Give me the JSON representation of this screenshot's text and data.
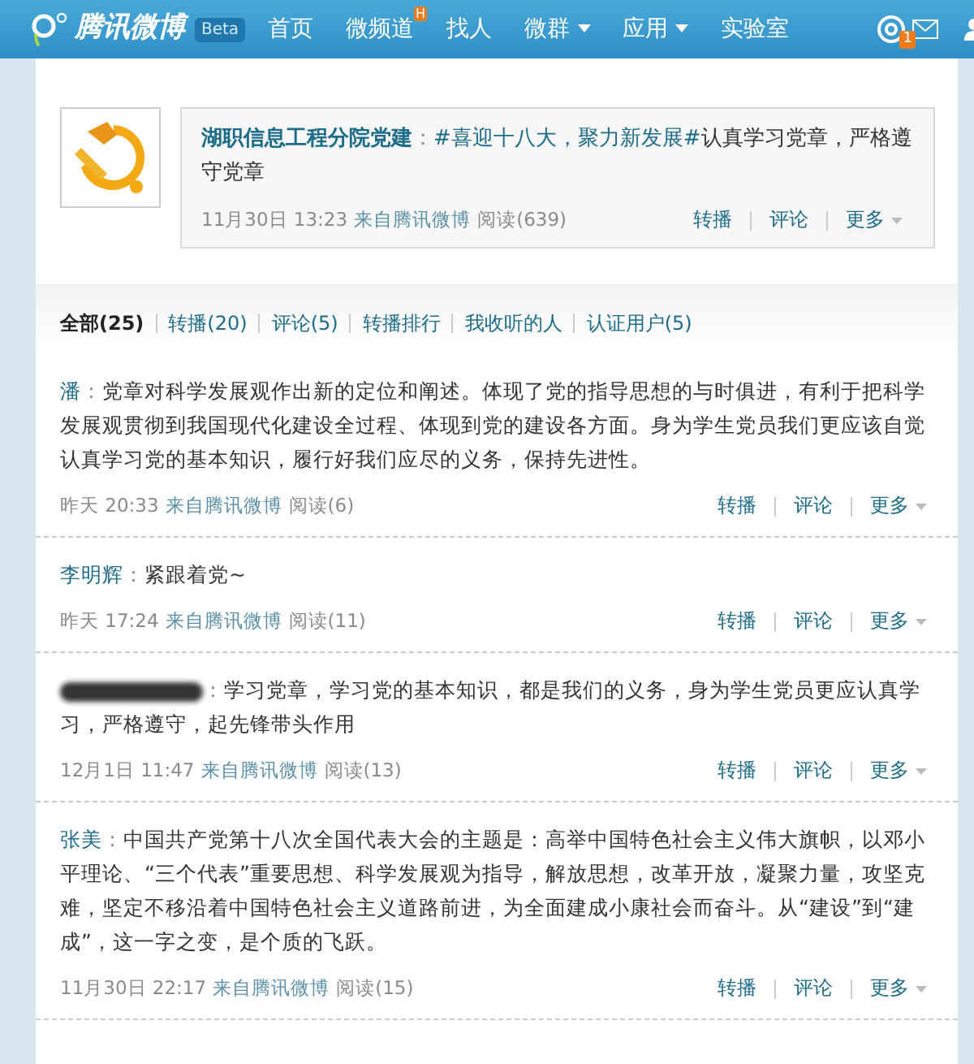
{
  "navbar": {
    "logo": "腾讯微博",
    "beta": "Beta",
    "items": [
      {
        "label": "首页",
        "hot": false,
        "dropdown": false
      },
      {
        "label": "微频道",
        "hot": true,
        "dropdown": false
      },
      {
        "label": "找人",
        "hot": false,
        "dropdown": false
      },
      {
        "label": "微群",
        "hot": false,
        "dropdown": true
      },
      {
        "label": "应用",
        "hot": false,
        "dropdown": true
      },
      {
        "label": "实验室",
        "hot": false,
        "dropdown": false
      }
    ],
    "hot_badge": "H",
    "mention_count": "1"
  },
  "original_post": {
    "author": "湖职信息工程分院党建",
    "colon": "：",
    "topic": "#喜迎十八大，聚力新发展#",
    "text": "认真学习党章，严格遵守党章",
    "time": "11月30日 13:23",
    "source": "来自腾讯微博",
    "reads": "阅读(639)",
    "actions": [
      "转播",
      "评论",
      "更多"
    ]
  },
  "filter_tabs": [
    {
      "label": "全部(25)",
      "selected": true
    },
    {
      "label": "转播(20)",
      "selected": false
    },
    {
      "label": "评论(5)",
      "selected": false
    },
    {
      "label": "转播排行",
      "selected": false
    },
    {
      "label": "我收听的人",
      "selected": false
    },
    {
      "label": "认证用户(5)",
      "selected": false
    }
  ],
  "comments": [
    {
      "author": "潘",
      "colon": "：",
      "redacted": false,
      "text": "党章对科学发展观作出新的定位和阐述。体现了党的指导思想的与时俱进，有利于把科学发展观贯彻到我国现代化建设全过程、体现到党的建设各方面。身为学生党员我们更应该自觉认真学习党的基本知识，履行好我们应尽的义务，保持先进性。",
      "time": "昨天 20:33",
      "source": "来自腾讯微博",
      "reads": "阅读(6)",
      "actions": [
        "转播",
        "评论",
        "更多"
      ]
    },
    {
      "author": "李明辉",
      "colon": "：",
      "redacted": false,
      "text": "紧跟着党~",
      "time": "昨天 17:24",
      "source": "来自腾讯微博",
      "reads": "阅读(11)",
      "actions": [
        "转播",
        "评论",
        "更多"
      ]
    },
    {
      "redacted": true,
      "colon": "：",
      "text": "学习党章，学习党的基本知识，都是我们的义务，身为学生党员更应认真学习，严格遵守，起先锋带头作用",
      "time": "12月1日 11:47",
      "source": "来自腾讯微博",
      "reads": "阅读(13)",
      "actions": [
        "转播",
        "评论",
        "更多"
      ]
    },
    {
      "author": "张美",
      "colon": "：",
      "redacted": false,
      "text": "中国共产党第十八次全国代表大会的主题是：高举中国特色社会主义伟大旗帜，以邓小平理论、“三个代表”重要思想、科学发展观为指导，解放思想，改革开放，凝聚力量，攻坚克难，坚定不移沿着中国特色社会主义道路前进，为全面建成小康社会而奋斗。从“建设”到“建成”，这一字之变，是个质的飞跃。",
      "time": "11月30日 22:17",
      "source": "来自腾讯微博",
      "reads": "阅读(15)",
      "actions": [
        "转播",
        "评论",
        "更多"
      ]
    }
  ]
}
